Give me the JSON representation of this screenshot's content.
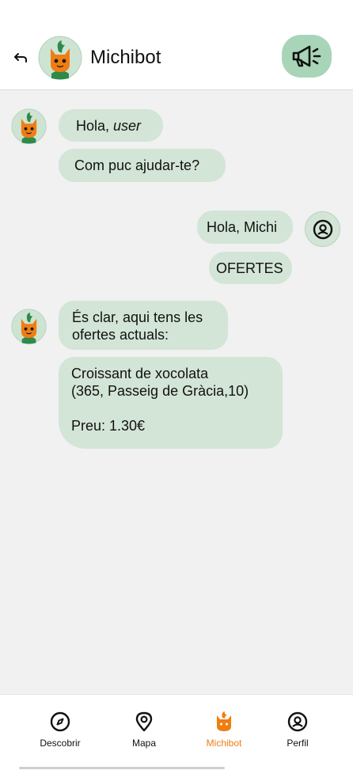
{
  "header": {
    "title": "Michibot"
  },
  "messages": {
    "bot1_greeting_prefix": "Hola, ",
    "bot1_greeting_user": "user",
    "bot2": "Com puc ajudar-te?",
    "user1": "Hola, Michi",
    "user2": "OFERTES",
    "bot3_line1": "És clar, aqui tens les",
    "bot3_line2": "ofertes actuals:",
    "offer_line1": "Croissant de xocolata",
    "offer_line2": "(365, Passeig de Gràcia,10)",
    "offer_price": "Preu: 1.30€"
  },
  "nav": {
    "items": [
      {
        "label": "Descobrir",
        "icon": "compass-icon"
      },
      {
        "label": "Mapa",
        "icon": "map-pin-icon"
      },
      {
        "label": "Michibot",
        "icon": "michibot-icon"
      },
      {
        "label": "Perfil",
        "icon": "profile-icon"
      }
    ],
    "active_color": "#f07d12"
  },
  "colors": {
    "bubble": "#d3e5d6",
    "accent_button": "#a8d5b8",
    "background": "#f1f1f1"
  }
}
